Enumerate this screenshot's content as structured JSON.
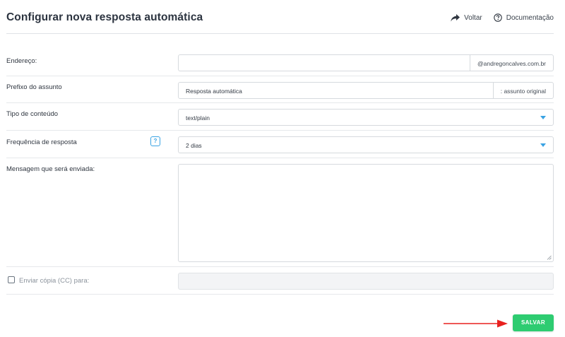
{
  "header": {
    "title": "Configurar nova resposta automática",
    "back_label": "Voltar",
    "docs_label": "Documentação"
  },
  "form": {
    "address": {
      "label": "Endereço:",
      "value": "",
      "domain_suffix": "@andregoncalves.com.br"
    },
    "subject_prefix": {
      "label": "Prefixo do assunto",
      "value": "Resposta automática",
      "suffix": ": assunto original"
    },
    "content_type": {
      "label": "Tipo de conteúdo",
      "selected": "text/plain"
    },
    "frequency": {
      "label": "Frequência de resposta",
      "help_icon_text": "?",
      "selected": "2 dias"
    },
    "message": {
      "label": "Mensagem que será enviada:",
      "value": ""
    },
    "cc": {
      "label": "Enviar cópia (CC) para:",
      "checked": false,
      "value": ""
    }
  },
  "actions": {
    "save_label": "SALVAR"
  },
  "colors": {
    "accent_blue": "#3aa3e3",
    "save_green": "#2ecc71",
    "annotation_arrow": "#e8211f"
  }
}
